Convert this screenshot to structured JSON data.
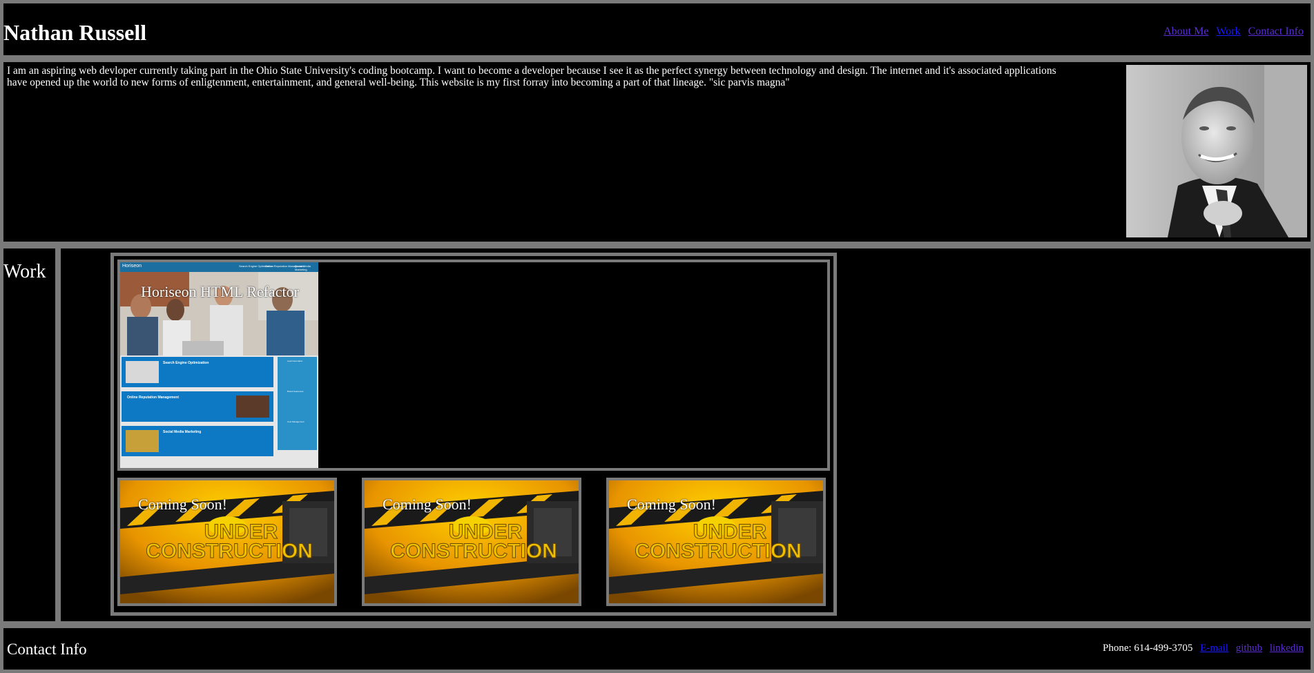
{
  "header": {
    "name": "Nathan Russell",
    "nav": [
      "About Me",
      "Work",
      "Contact Info"
    ]
  },
  "about": {
    "text": "I am an aspiring web devloper currently taking part in the Ohio State University's coding bootcamp. I want to become a developer because I see it as the perfect synergy between technology and design. The internet and it's associated applications have opened up the world to new forms of enligtenment, entertainment, and general well-being. This website is my first forray into becoming a part of that lineage. \"sic parvis magna\""
  },
  "work": {
    "title": "Work",
    "featured": {
      "label": "Horiseon HTML Refactor",
      "thumb": {
        "brand": "Horiseon",
        "nav": [
          "Search Engine Optimization",
          "Online Reputation Management",
          "Social Media Marketing"
        ],
        "sections": [
          "Search Engine Optimization",
          "Online Reputation Management",
          "Social Media Marketing"
        ],
        "sidebar": [
          "Lead Generation",
          "Brand Awareness",
          "Cost Management"
        ]
      }
    },
    "coming_soon": [
      {
        "label": "Coming Soon!",
        "line1": "UNDER",
        "line2": "CONSTRUCTION"
      },
      {
        "label": "Coming Soon!",
        "line1": "UNDER",
        "line2": "CONSTRUCTION"
      },
      {
        "label": "Coming Soon!",
        "line1": "UNDER",
        "line2": "CONSTRUCTION"
      }
    ]
  },
  "contact": {
    "title": "Contact Info",
    "phone": "Phone: 614-499-3705",
    "links": [
      "E-mail",
      "github",
      "linkedin"
    ]
  },
  "colors": {
    "background": "#000000",
    "border": "#7a7a7a",
    "link": "#5b2dd6",
    "link_active": "#1a1aff",
    "construction_yellow": "#f5a800"
  }
}
